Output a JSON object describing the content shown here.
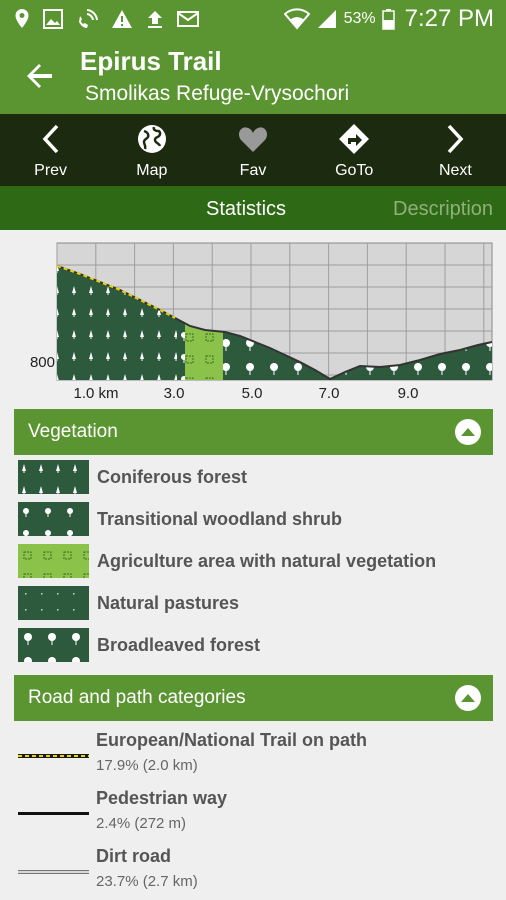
{
  "status_bar": {
    "battery": "53%",
    "time": "7:27 PM",
    "icons": [
      "location-icon",
      "image-icon",
      "wifi-calling-icon",
      "warning-icon",
      "upload-icon",
      "mail-icon",
      "wifi-icon",
      "signal-icon",
      "battery-icon"
    ]
  },
  "app_bar": {
    "title": "Epirus Trail",
    "subtitle": "Smolikas Refuge-Vrysochori"
  },
  "toolbar": {
    "items": [
      {
        "label": "Prev",
        "icon": "chevron-left-icon"
      },
      {
        "label": "Map",
        "icon": "globe-icon"
      },
      {
        "label": "Fav",
        "icon": "heart-icon"
      },
      {
        "label": "GoTo",
        "icon": "directions-icon"
      },
      {
        "label": "Next",
        "icon": "chevron-right-icon"
      }
    ]
  },
  "tabs": [
    {
      "label": "Statistics",
      "active": true
    },
    {
      "label": "Description",
      "active": false
    }
  ],
  "chart_data": {
    "type": "area",
    "y_tick_labels": [
      "800"
    ],
    "x_tick_labels": [
      "1.0 km",
      "3.0",
      "5.0",
      "7.0",
      "9.0"
    ],
    "xlim": [
      0,
      11.2
    ],
    "grid": true
  },
  "vegetation": {
    "header": "Vegetation",
    "items": [
      {
        "label": "Coniferous forest"
      },
      {
        "label": "Transitional woodland shrub"
      },
      {
        "label": "Agriculture area with natural vegetation"
      },
      {
        "label": "Natural pastures"
      },
      {
        "label": "Broadleaved forest"
      }
    ]
  },
  "roads": {
    "header": "Road and path categories",
    "items": [
      {
        "name": "European/National Trail on path",
        "stat": "17.9% (2.0 km)"
      },
      {
        "name": "Pedestrian way",
        "stat": "2.4% (272 m)"
      },
      {
        "name": "Dirt road",
        "stat": "23.7% (2.7 km)"
      }
    ]
  },
  "colors": {
    "header_green": "#5a9531",
    "toolbar_dark": "#1c2b10",
    "tab_green": "#2e6a16",
    "forest_dark": "#2d5a3c",
    "agri_green": "#8bc34a",
    "trail_yellow": "#e8d400"
  }
}
